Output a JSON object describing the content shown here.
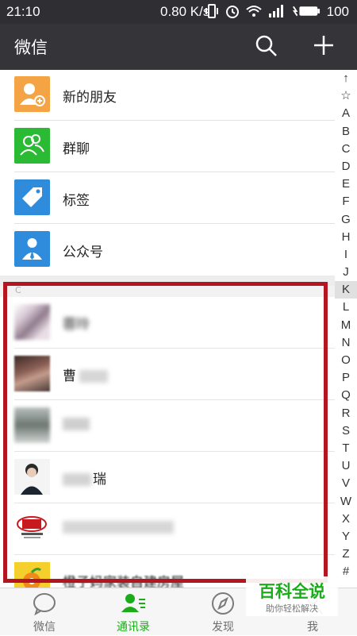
{
  "status_bar": {
    "time": "21:10",
    "net_speed": "0.80 K/s",
    "battery": "100",
    "icons": [
      "vibrate-icon",
      "alarm-icon",
      "wifi-icon",
      "signal-icon",
      "battery-icon"
    ]
  },
  "app_bar": {
    "title": "微信",
    "icons": [
      "search-icon",
      "add-icon"
    ]
  },
  "fixed_items": [
    {
      "label": "新的朋友",
      "icon": "add-person-icon",
      "color": "#f5a445"
    },
    {
      "label": "群聊",
      "icon": "group-icon",
      "color": "#2bba34"
    },
    {
      "label": "标签",
      "icon": "tag-icon",
      "color": "#2f8cdc"
    },
    {
      "label": "公众号",
      "icon": "official-account-icon",
      "color": "#2f8cdc"
    }
  ],
  "section_letter": "C",
  "contacts": [
    {
      "name": "蓉玲"
    },
    {
      "name": "曹"
    },
    {
      "name": ""
    },
    {
      "name": "瑞"
    },
    {
      "name": ""
    },
    {
      "name": "橙子妈家装自建房屋"
    }
  ],
  "index_letters": [
    "↑",
    "☆",
    "A",
    "B",
    "C",
    "D",
    "E",
    "F",
    "G",
    "H",
    "I",
    "J",
    "K",
    "L",
    "M",
    "N",
    "O",
    "P",
    "Q",
    "R",
    "S",
    "T",
    "U",
    "V",
    "W",
    "X",
    "Y",
    "Z",
    "#"
  ],
  "index_selected": "K",
  "tab_bar": {
    "tabs": [
      {
        "label": "微信",
        "icon": "chat-icon",
        "active": false
      },
      {
        "label": "通讯录",
        "icon": "contacts-icon",
        "active": true
      },
      {
        "label": "发现",
        "icon": "compass-icon",
        "active": false
      },
      {
        "label": "我",
        "icon": "me-icon",
        "active": false
      }
    ]
  },
  "watermark": {
    "title": "百科全说",
    "subtitle": "助你轻松解决"
  },
  "colors": {
    "accent": "#1aad19",
    "highlight_border": "#b51520",
    "header_bg": "#353539"
  }
}
